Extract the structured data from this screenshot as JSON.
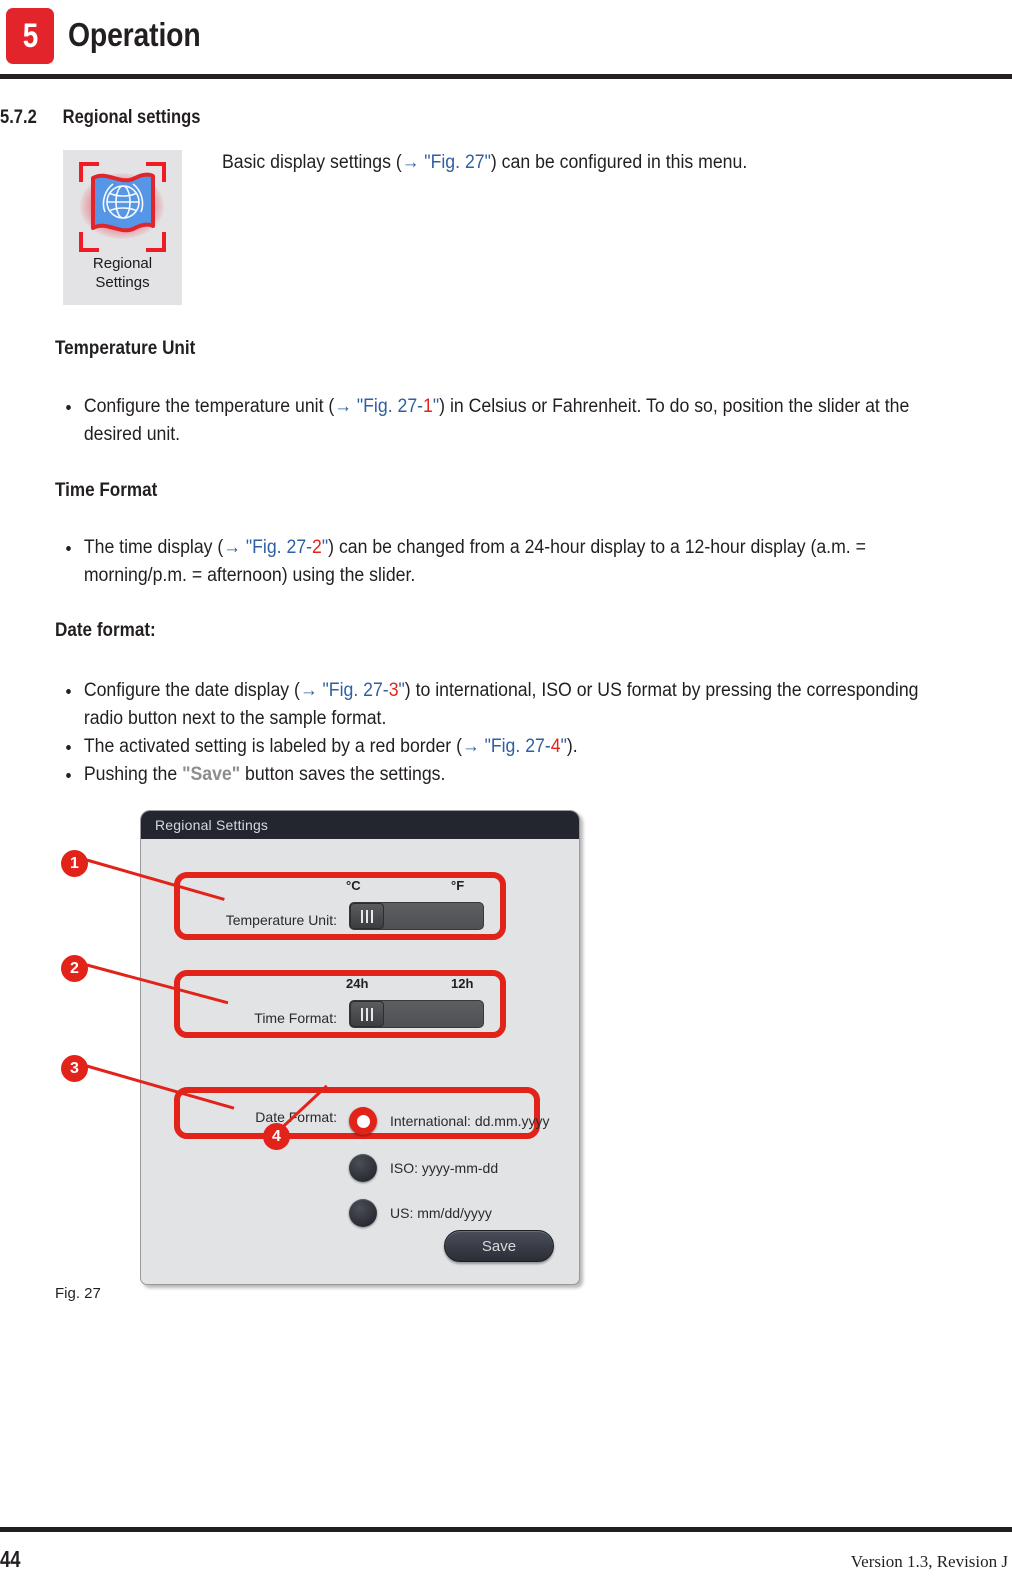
{
  "header": {
    "chapter_number": "5",
    "chapter_title": "Operation"
  },
  "section": {
    "number": "5.7.2",
    "title": "Regional settings"
  },
  "menu_icon": {
    "label_line1": "Regional",
    "label_line2": "Settings",
    "icon_name": "un-flag-icon"
  },
  "intro": {
    "part1": "Basic display settings (",
    "xref_arrow": "→ \"Fig. 27\"",
    "part2": ") can be configured in this menu."
  },
  "temperature": {
    "heading": "Temperature Unit",
    "bullet": {
      "t1": "Configure the temperature unit (",
      "x1": "→ \"Fig. 27-",
      "xn": "1",
      "x2": "\"",
      "t2": ") in Celsius or Fahrenheit. To do so, position the slider at the desired unit."
    }
  },
  "time": {
    "heading": "Time Format",
    "bullet": {
      "t1": "The time display (",
      "x1": "→ \"Fig. 27-",
      "xn": "2",
      "x2": "\"",
      "t2": ") can be changed from a 24-hour display to a 12-hour display (a.m. = morning/p.m. = afternoon) using the slider."
    }
  },
  "date": {
    "heading": "Date format:",
    "bullet1": {
      "t1": "Configure the date display (",
      "x1": "→ \"Fig. 27-",
      "xn": "3",
      "x2": "\"",
      "t2": ") to international, ISO or US format by pressing the corresponding radio button next to the sample format."
    },
    "bullet2": {
      "t1": "The activated setting is labeled by a red border (",
      "x1": "→ \"Fig. 27-",
      "xn": "4",
      "x2": "\"",
      "t2": ")."
    },
    "bullet3": {
      "t1": "Pushing the ",
      "save": "\"Save\"",
      "t2": " button saves the settings."
    }
  },
  "dialog": {
    "title": "Regional Settings",
    "temperature_row": {
      "label": "Temperature Unit:",
      "scale_left": "°C",
      "scale_right": "°F",
      "slider_position": "left"
    },
    "time_row": {
      "label": "Time Format:",
      "scale_left": "24h",
      "scale_right": "12h",
      "slider_position": "left"
    },
    "date_row": {
      "label": "Date Format:",
      "options": [
        {
          "label": "International: dd.mm.yyyy",
          "selected": true
        },
        {
          "label": "ISO: yyyy-mm-dd",
          "selected": false
        },
        {
          "label": "US: mm/dd/yyyy",
          "selected": false
        }
      ]
    },
    "save_button": "Save"
  },
  "callouts": [
    {
      "number": "1"
    },
    {
      "number": "2"
    },
    {
      "number": "3"
    },
    {
      "number": "4"
    }
  ],
  "figure_caption": "Fig. 27",
  "footer": {
    "page_number": "44",
    "version": "Version 1.3, Revision J"
  },
  "colors": {
    "brand_red": "#e2231a",
    "xref_blue": "#2e5fa3",
    "ink": "#231f20",
    "dialog_bg": "#e2e3e5",
    "titlebar": "#23262f"
  }
}
